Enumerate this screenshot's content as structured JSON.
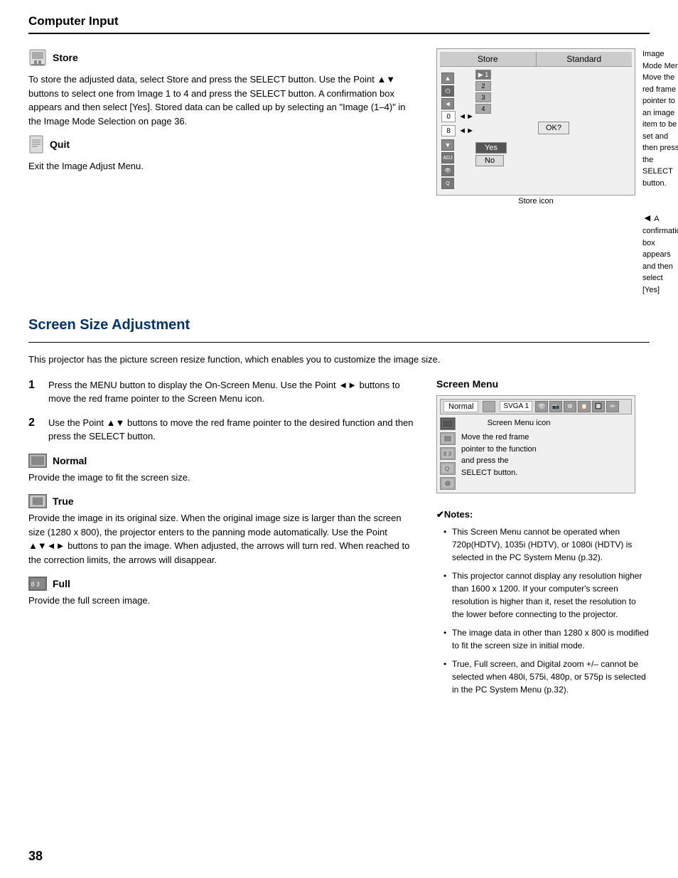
{
  "page": {
    "title": "Computer Input",
    "page_number": "38"
  },
  "store_section": {
    "heading": "Store",
    "text": "To store the adjusted data, select Store and press the SELECT button. Use the Point ▲▼ buttons to select one from Image 1 to 4 and press the SELECT button. A confirmation box appears and then select [Yes]. Stored data can be called up by selecting an \"Image (1–4)\" in the Image Mode Selection on page 36.",
    "diagram": {
      "header_left": "Store",
      "header_right": "Standard",
      "input1_value": "0",
      "input2_value": "8",
      "ok_label": "OK?",
      "yes_label": "Yes",
      "no_label": "No",
      "store_icon_caption": "Store icon",
      "annotation_image_mode": "Image Mode Menu\nMove the red frame\npointer to an image\nitem to be set and\nthen press the\nSELECT button.",
      "annotation_confirmation": "A confirmation\nbox appears\nand then select\n[Yes]"
    }
  },
  "quit_section": {
    "heading": "Quit",
    "text": "Exit the Image Adjust Menu."
  },
  "screen_size_section": {
    "title": "Screen Size Adjustment",
    "intro": "This projector has the picture screen resize function, which enables you to customize the image size.",
    "steps": [
      {
        "number": "1",
        "text": "Press the MENU button to display the On-Screen Menu. Use the Point ◄► buttons to move the red frame pointer to the Screen Menu icon."
      },
      {
        "number": "2",
        "text": "Use the Point ▲▼ buttons to move the red frame pointer to the desired function and then press the SELECT button."
      }
    ],
    "features": [
      {
        "id": "normal",
        "label": "Normal",
        "text": "Provide the image to fit the screen size."
      },
      {
        "id": "true",
        "label": "True",
        "text": "Provide the image in its original size. When the original image size is larger than the screen size (1280 x 800), the projector enters to the panning mode automatically. Use the Point ▲▼◄► buttons to pan the image. When adjusted, the arrows will turn red. When reached to the correction limits, the arrows will disappear."
      },
      {
        "id": "full",
        "label": "Full",
        "text": "Provide the full screen image."
      }
    ],
    "screen_menu": {
      "title": "Screen Menu",
      "normal_label": "Normal",
      "svga_label": "SVGA 1",
      "caption_icon": "Screen Menu icon",
      "caption_pointer": "Move the red frame\npointer to the function\nand press the\nSELECT button."
    },
    "notes": {
      "title": "✔Notes:",
      "items": [
        "This Screen Menu cannot be operated when 720p(HDTV), 1035i (HDTV), or 1080i (HDTV) is selected in the PC System Menu (p.32).",
        "This projector cannot display any resolution higher than 1600 x 1200. If your computer's screen resolution is higher than it, reset the resolution to the lower before connecting to the projector.",
        "The image data in other than 1280 x 800 is modified to fit the screen size in initial mode.",
        "True, Full screen, and Digital zoom +/– cannot be selected when 480i, 575i, 480p, or 575p is selected in the PC System Menu (p.32)."
      ]
    }
  }
}
